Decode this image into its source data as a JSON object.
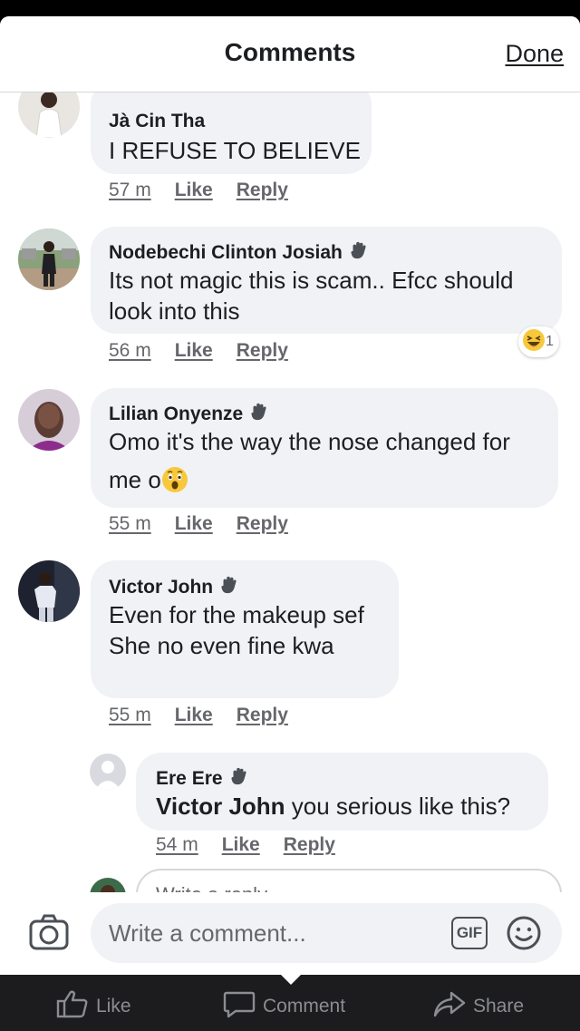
{
  "header": {
    "title": "Comments",
    "done_label": "Done"
  },
  "comments": [
    {
      "author": "Jà Cin Tha",
      "text_lines": [
        "I REFUSE TO BELIEVE"
      ],
      "time": "57 m",
      "like_label": "Like",
      "reply_label": "Reply"
    },
    {
      "author": "Nodebechi Clinton Josiah",
      "text_lines": [
        "Its not magic this is scam.. Efcc should",
        "look into this"
      ],
      "time": "56 m",
      "like_label": "Like",
      "reply_label": "Reply",
      "reaction": {
        "emoji": "laughing",
        "count": "1"
      }
    },
    {
      "author": "Lilian Onyenze",
      "text_lines": [
        "Omo it's the way the nose changed for",
        "me o"
      ],
      "time": "55 m",
      "like_label": "Like",
      "reply_label": "Reply"
    },
    {
      "author": "Victor John",
      "text_lines": [
        "Even for the makeup sef",
        "She no even fine kwa"
      ],
      "time": "55 m",
      "like_label": "Like",
      "reply_label": "Reply"
    }
  ],
  "reply": {
    "author": "Ere Ere",
    "mention": "Victor John",
    "text": " you serious like this?",
    "time": "54 m",
    "like_label": "Like",
    "reply_label": "Reply"
  },
  "reply_box": {
    "placeholder": "Write a reply..."
  },
  "composer": {
    "placeholder": "Write a comment...",
    "gif_label": "GIF"
  },
  "bottom_bar": {
    "like": "Like",
    "comment": "Comment",
    "share": "Share"
  },
  "colors": {
    "bubble": "#f0f2f5",
    "text": "#1c1e21",
    "muted": "#65676b",
    "bar": "#1c1c1e"
  }
}
